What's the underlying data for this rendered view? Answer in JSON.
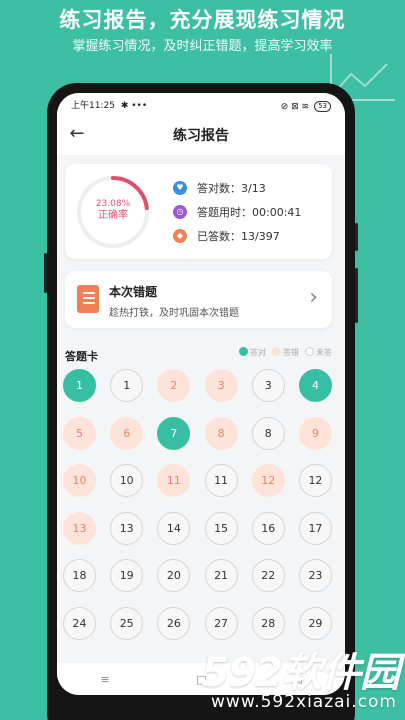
{
  "promo": {
    "title": "练习报告，充分展现练习情况",
    "subtitle": "掌握练习情况，及时纠正错题，提高学习效率"
  },
  "status_bar": {
    "time": "上午11:25",
    "extra": "✱ •••",
    "right_icons": "⊘ ⊠ ≋",
    "battery": "53"
  },
  "navbar": {
    "back_icon": "←",
    "title": "练习报告"
  },
  "stats": {
    "percent_text": "23.08%",
    "rate_label": "正确率",
    "rate_fraction": 0.2308,
    "correct_count": "答对数：3/13",
    "time_used": "答题用时：00:00:41",
    "answered": "已答数：13/397",
    "colors": {
      "ring_fill": "#e0506a",
      "ring_track": "#eeeeee",
      "icon_blue": "#3a8fe0",
      "icon_purple": "#9b59d0",
      "icon_orange": "#f08055"
    }
  },
  "wrong_card": {
    "title": "本次错题",
    "subtitle": "趁热打铁，及时巩固本次错题",
    "icon": "notebook-icon"
  },
  "answer_card": {
    "label": "答题卡",
    "legend": [
      {
        "label": "答对",
        "color": "#36bfa3"
      },
      {
        "label": "答错",
        "color": "#fde3d8"
      },
      {
        "label": "未答",
        "color": "#ffffff"
      }
    ],
    "questions": [
      {
        "num": "1",
        "state": "correct"
      },
      {
        "num": "1",
        "state": "unanswered"
      },
      {
        "num": "2",
        "state": "wrong"
      },
      {
        "num": "3",
        "state": "wrong"
      },
      {
        "num": "3",
        "state": "unanswered"
      },
      {
        "num": "4",
        "state": "correct"
      },
      {
        "num": "5",
        "state": "wrong"
      },
      {
        "num": "6",
        "state": "wrong"
      },
      {
        "num": "7",
        "state": "correct"
      },
      {
        "num": "8",
        "state": "wrong"
      },
      {
        "num": "8",
        "state": "unanswered"
      },
      {
        "num": "9",
        "state": "wrong"
      },
      {
        "num": "10",
        "state": "wrong"
      },
      {
        "num": "10",
        "state": "unanswered"
      },
      {
        "num": "11",
        "state": "wrong"
      },
      {
        "num": "11",
        "state": "unanswered"
      },
      {
        "num": "12",
        "state": "wrong"
      },
      {
        "num": "12",
        "state": "unanswered"
      },
      {
        "num": "13",
        "state": "wrong"
      },
      {
        "num": "13",
        "state": "unanswered"
      },
      {
        "num": "14",
        "state": "unanswered"
      },
      {
        "num": "15",
        "state": "unanswered"
      },
      {
        "num": "16",
        "state": "unanswered"
      },
      {
        "num": "17",
        "state": "unanswered"
      },
      {
        "num": "18",
        "state": "unanswered"
      },
      {
        "num": "19",
        "state": "unanswered"
      },
      {
        "num": "20",
        "state": "unanswered"
      },
      {
        "num": "21",
        "state": "unanswered"
      },
      {
        "num": "22",
        "state": "unanswered"
      },
      {
        "num": "23",
        "state": "unanswered"
      },
      {
        "num": "24",
        "state": "unanswered"
      },
      {
        "num": "25",
        "state": "unanswered"
      },
      {
        "num": "26",
        "state": "unanswered"
      },
      {
        "num": "27",
        "state": "unanswered"
      },
      {
        "num": "28",
        "state": "unanswered"
      },
      {
        "num": "29",
        "state": "unanswered"
      }
    ]
  },
  "bottom_nav": {
    "menu": "≡",
    "home": "□",
    "back": "◁"
  },
  "watermark": {
    "main": "592软件园",
    "url": "www.592xiazai.com"
  }
}
